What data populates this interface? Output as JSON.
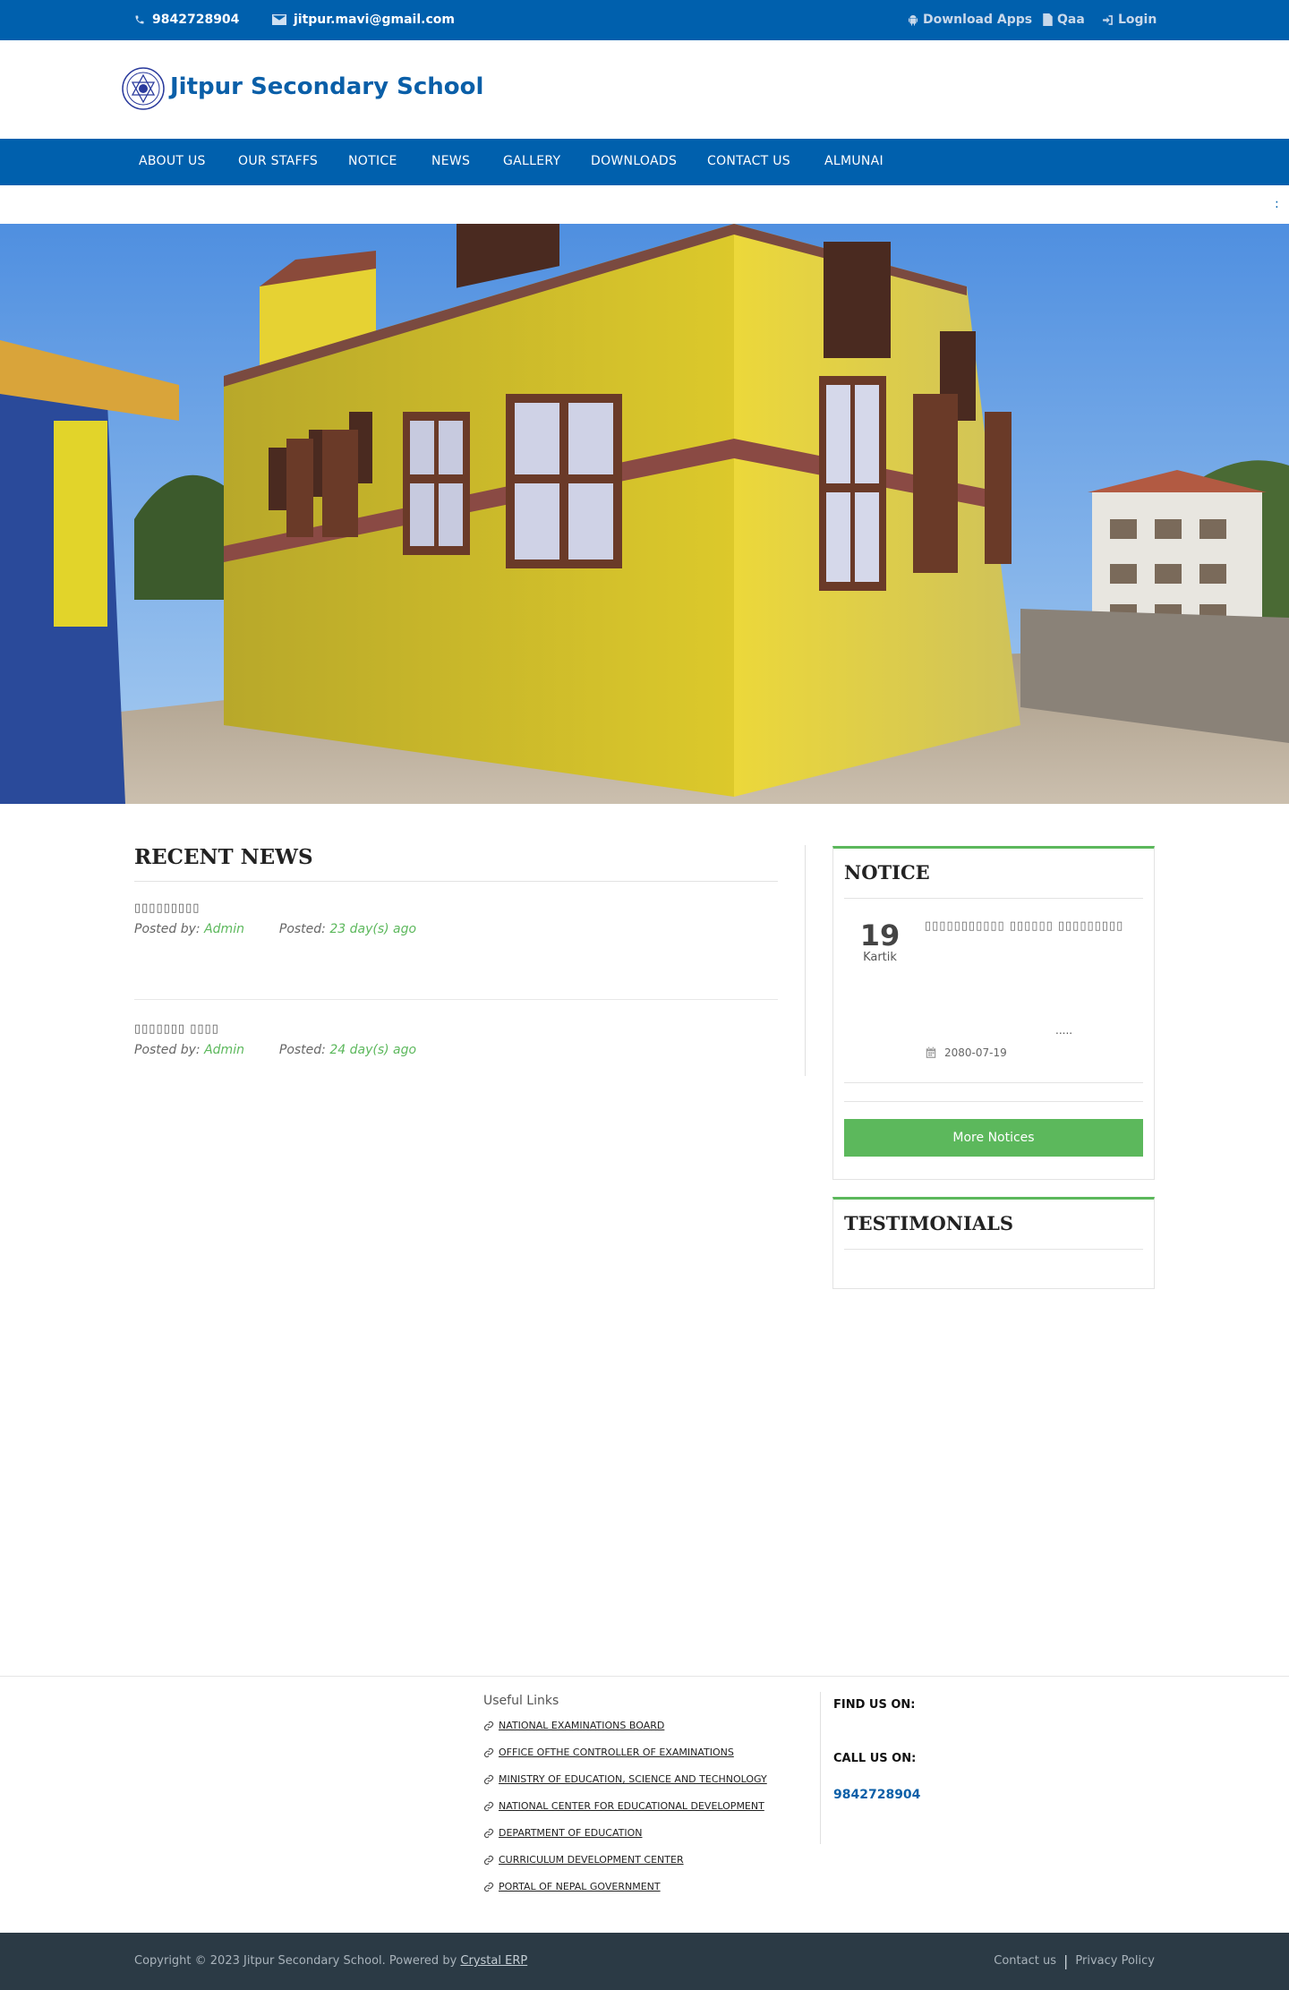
{
  "topbar": {
    "phone": "9842728904",
    "email": "jitpur.mavi@gmail.com",
    "download_apps": "Download Apps",
    "qaa": "Qaa",
    "login": "Login"
  },
  "header": {
    "title": "Jitpur Secondary School"
  },
  "nav": {
    "items": [
      "ABOUT US",
      "OUR STAFFS",
      "NOTICE",
      "NEWS",
      "GALLERY",
      "DOWNLOADS",
      "CONTACT US",
      "ALMUNAI"
    ]
  },
  "marquee": {
    "text": ":"
  },
  "recent_news": {
    "title": "RECENT NEWS",
    "posted_by_label": "Posted by:",
    "posted_label": "Posted:",
    "items": [
      {
        "title": "▯▯▯▯▯▯▯▯▯",
        "author": "Admin",
        "posted": "23 day(s) ago"
      },
      {
        "title": "▯▯▯▯▯▯▯ ▯▯▯▯",
        "author": "Admin",
        "posted": "24 day(s) ago"
      }
    ]
  },
  "notice": {
    "title": "NOTICE",
    "day": "19",
    "month": "Kartik",
    "item_title": "▯▯▯▯▯▯▯▯▯▯▯ ▯▯▯▯▯▯ ▯▯▯▯▯▯▯▯▯",
    "ellipsis": ".....",
    "date": "2080-07-19",
    "more_button": "More Notices"
  },
  "testimonials": {
    "title": "TESTIMONIALS"
  },
  "footer": {
    "useful_links_title": "Useful Links",
    "links": [
      "NATIONAL EXAMINATIONS BOARD",
      "OFFICE OFTHE CONTROLLER OF EXAMINATIONS",
      "MINISTRY OF EDUCATION, SCIENCE AND TECHNOLOGY",
      "NATIONAL CENTER FOR EDUCATIONAL DEVELOPMENT",
      "DEPARTMENT OF EDUCATION",
      "CURRICULUM DEVELOPMENT CENTER",
      "PORTAL OF NEPAL GOVERNMENT"
    ],
    "find_us": "FIND US ON:",
    "call_us": "CALL US ON:",
    "phone": "9842728904",
    "copyright": "Copyright © 2023 Jitpur Secondary School. Powered by",
    "powered_by": "Crystal ERP",
    "contact_us": "Contact us",
    "privacy": "Privacy Policy"
  },
  "colors": {
    "primary_blue": "#0060ad",
    "accent_green": "#5cb85c",
    "footer_dark": "#2b3a45"
  }
}
